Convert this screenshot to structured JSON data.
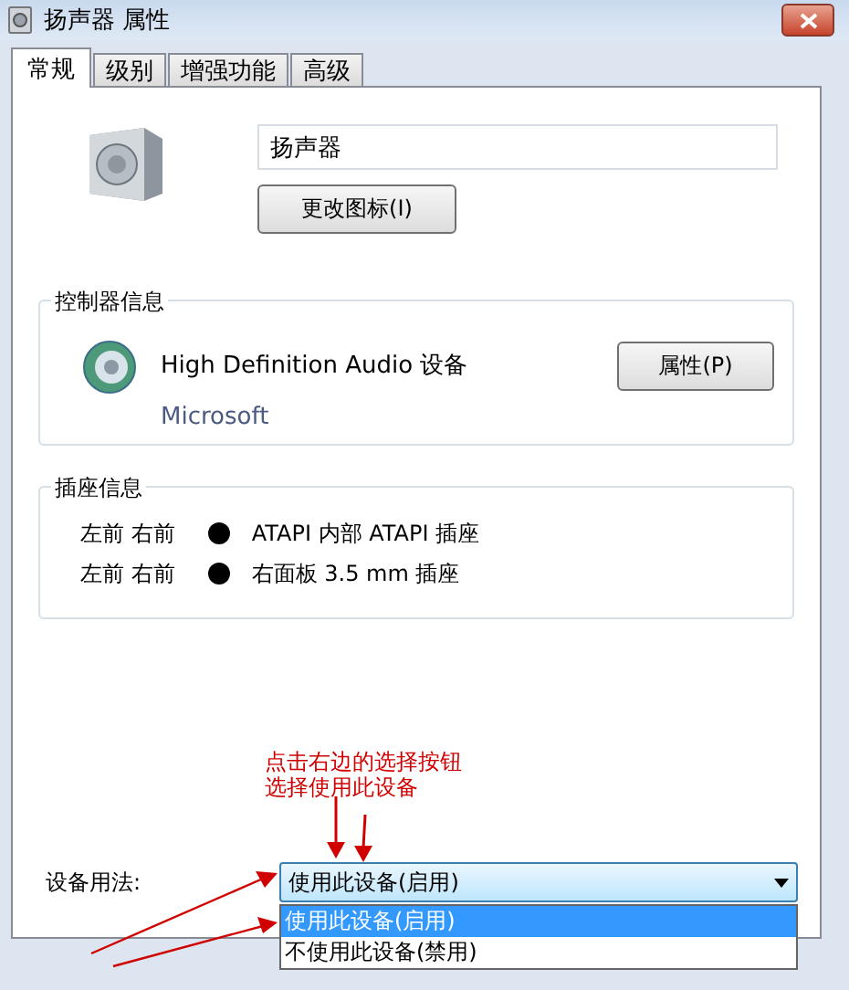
{
  "window": {
    "title": "扬声器 属性"
  },
  "tabs": [
    {
      "label": "常规",
      "selected": true
    },
    {
      "label": "级别",
      "selected": false
    },
    {
      "label": "增强功能",
      "selected": false
    },
    {
      "label": "高级",
      "selected": false
    }
  ],
  "general": {
    "name": "扬声器",
    "change_icon_button": "更改图标(I)"
  },
  "controller": {
    "title": "控制器信息",
    "device": "High Definition Audio 设备",
    "vendor": "Microsoft",
    "button": "属性(P)"
  },
  "jacks": {
    "title": "插座信息",
    "rows": [
      {
        "channels": "左前 右前",
        "color": "#000000",
        "label": "ATAPI 内部 ATAPI 插座"
      },
      {
        "channels": "左前 右前",
        "color": "#000000",
        "label": "右面板 3.5 mm 插座"
      }
    ]
  },
  "usage": {
    "label": "设备用法:",
    "value": "使用此设备(启用)",
    "expanded": true,
    "options": [
      {
        "label": "使用此设备(启用)",
        "selected": true
      },
      {
        "label": "不使用此设备(禁用)",
        "selected": false
      }
    ]
  },
  "annotation": {
    "lines": [
      "点击右边的选择按钮",
      "选择使用此设备"
    ]
  }
}
